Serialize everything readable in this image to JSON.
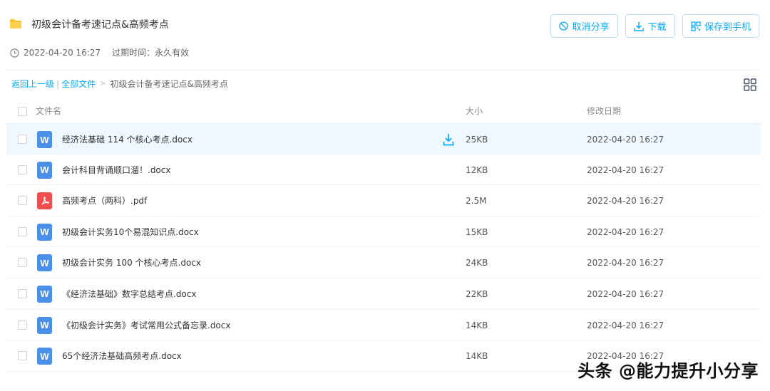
{
  "header": {
    "title": "初级会计备考速记点&高频考点",
    "created": "2022-04-20 16:27",
    "expire": "过期时间：永久有效",
    "buttons": {
      "cancel_share": "取消分享",
      "download": "下载",
      "save_to_phone": "保存到手机"
    }
  },
  "breadcrumb": {
    "back": "返回上一级",
    "sep": "|",
    "all_files": "全部文件",
    "arrow": ">",
    "current": "初级会计备考速记点&高频考点"
  },
  "table": {
    "headers": {
      "name": "文件名",
      "size": "大小",
      "date": "修改日期"
    },
    "rows": [
      {
        "type": "word",
        "name": "经济法基础 114 个核心考点.docx",
        "size": "25KB",
        "date": "2022-04-20 16:27"
      },
      {
        "type": "word",
        "name": "会计科目背诵顺口溜！.docx",
        "size": "12KB",
        "date": "2022-04-20 16:27"
      },
      {
        "type": "pdf",
        "name": "高频考点（两科）.pdf",
        "size": "2.5M",
        "date": "2022-04-20 16:27"
      },
      {
        "type": "word",
        "name": "初级会计实务10个易混知识点.docx",
        "size": "15KB",
        "date": "2022-04-20 16:27"
      },
      {
        "type": "word",
        "name": "初级会计实务 100 个核心考点.docx",
        "size": "24KB",
        "date": "2022-04-20 16:27"
      },
      {
        "type": "word",
        "name": "《经济法基础》数字总结考点.docx",
        "size": "22KB",
        "date": "2022-04-20 16:27"
      },
      {
        "type": "word",
        "name": "《初级会计实务》考试常用公式备忘录.docx",
        "size": "14KB",
        "date": "2022-04-20 16:27"
      },
      {
        "type": "word",
        "name": "65个经济法基础高频考点.docx",
        "size": "14KB",
        "date": "2022-04-20 16:27"
      }
    ]
  },
  "icons": {
    "word_glyph": "W",
    "folder": "folder-icon",
    "clock": "clock-icon",
    "grid": "grid-view-icon",
    "download": "download-icon",
    "cancel": "cancel-icon",
    "qr": "qr-icon"
  },
  "colors": {
    "accent": "#09AAFF",
    "word": "#4a90e8",
    "pdf": "#ef4e4e",
    "hover_row": "#f0f8ff"
  },
  "watermark": "头条 @能力提升小分享"
}
